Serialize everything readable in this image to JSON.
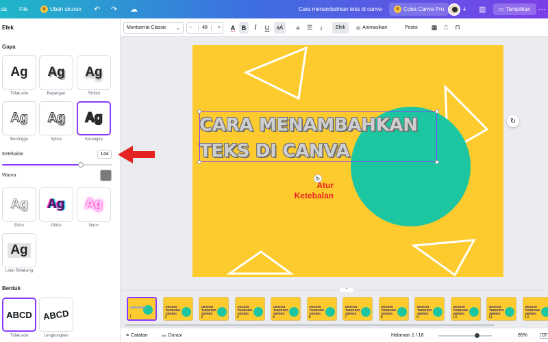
{
  "topbar": {
    "home_fragment": "da",
    "file_label": "File",
    "resize_label": "Ubah ukuran",
    "doc_title": "Cara menambahkan teks di canva",
    "pro_label": "Coba Canva Pro",
    "share_label": "Tampilkan",
    "plus": "+"
  },
  "panel": {
    "title": "Efek",
    "styles_label": "Gaya",
    "styles": [
      {
        "glyph": "Ag",
        "caption": "Tidak ada"
      },
      {
        "glyph": "Ag",
        "caption": "Bayangan"
      },
      {
        "glyph": "Ag",
        "caption": "Timbul"
      },
      {
        "glyph": "Ag",
        "caption": "Berongga"
      },
      {
        "glyph": "Ag",
        "caption": "Splice"
      },
      {
        "glyph": "Ag",
        "caption": "Kerangka"
      },
      {
        "glyph": "Ag",
        "caption": "Echo"
      },
      {
        "glyph": "Ag",
        "caption": "Glitch"
      },
      {
        "glyph": "Ag",
        "caption": "Neon"
      },
      {
        "glyph": "Ag",
        "caption": "Latar Belakang"
      }
    ],
    "thickness_label": "Ketebalan",
    "thickness_value": "144",
    "thickness_fraction": 0.72,
    "color_label": "Warna",
    "shape_label": "Bentuk",
    "shapes": [
      {
        "glyph": "ABCD",
        "caption": "Tidak ada"
      },
      {
        "glyph": "ABCD",
        "caption": "Lengkungkan"
      }
    ]
  },
  "propbar": {
    "font_name": "Montserrat Classic",
    "font_size": "48",
    "minus": "−",
    "plus": "+",
    "effects_label": "Efek",
    "animate_label": "Animasikan",
    "position_label": "Posisi"
  },
  "canvas": {
    "headline_line1": "CARA MENAMBAHKAN",
    "headline_line2": "TEKS DI CANVA"
  },
  "annotation": {
    "line1": "Atur",
    "line2": "Ketebalan",
    "color": "#e52323"
  },
  "strip": {
    "thumb_text1": "DESIGN",
    "thumb_text2": "THINKING",
    "thumb_text3": "SERIES",
    "pages": [
      "1",
      "2",
      "3",
      "4",
      "5",
      "6",
      "7",
      "8",
      "9",
      "10",
      "11",
      "12"
    ]
  },
  "footer": {
    "notes_label": "Catatan",
    "duration_label": "Durasi",
    "page_indicator": "Halaman 1 / 16",
    "zoom_value": "85%",
    "zoom_fraction": 0.72,
    "page_count_badge": "16"
  },
  "colors": {
    "accent": "#8b3dff",
    "page_bg": "#fecb2f",
    "circle": "#1cc6a1"
  }
}
